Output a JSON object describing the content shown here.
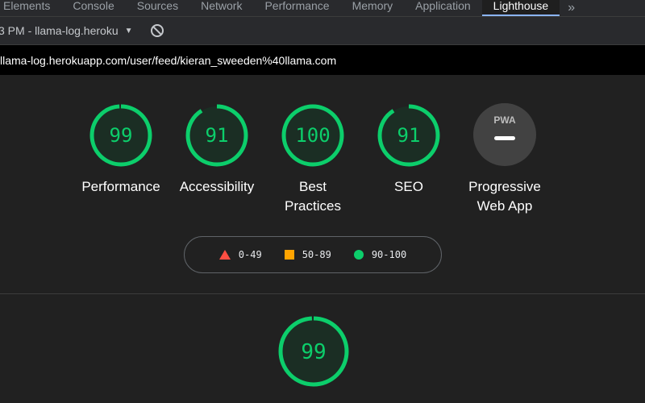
{
  "devtools": {
    "tabs": [
      "Elements",
      "Console",
      "Sources",
      "Network",
      "Performance",
      "Memory",
      "Application",
      "Lighthouse"
    ],
    "active_tab": "Lighthouse",
    "more_tabs_glyph": "»"
  },
  "toolbar": {
    "report_select": "3 PM - llama-log.heroku",
    "clear_icon": "block-icon"
  },
  "url": "llama-log.herokuapp.com/user/feed/kieran_sweeden%40llama.com",
  "scores": [
    {
      "label": "Performance",
      "score": 99
    },
    {
      "label": "Accessibility",
      "score": 91
    },
    {
      "label": "Best\nPractices",
      "score": 100
    },
    {
      "label": "SEO",
      "score": 91
    }
  ],
  "pwa": {
    "label": "Progressive\nWeb App",
    "badge_text": "PWA"
  },
  "legend": [
    {
      "range": "0-49",
      "shape": "triangle",
      "color": "#ff4e42"
    },
    {
      "range": "50-89",
      "shape": "square",
      "color": "#ffa400"
    },
    {
      "range": "90-100",
      "shape": "circle",
      "color": "#0cce6b"
    }
  ],
  "detail_score": 99,
  "colors": {
    "pass": "#0cce6b",
    "pass_bg": "#1b2e24",
    "background": "#212121"
  }
}
